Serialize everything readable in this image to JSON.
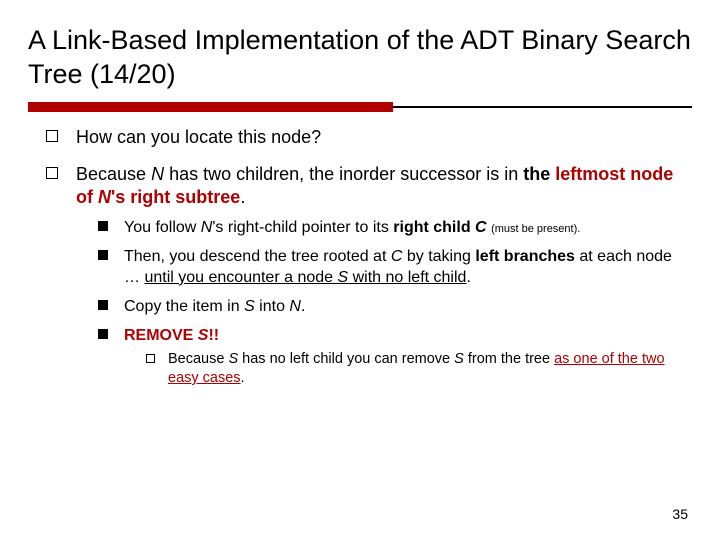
{
  "title": "A Link-Based Implementation of the ADT Binary Search Tree (14/20)",
  "bullets": {
    "b1": "How can you locate this node?",
    "b2_pre": "Because ",
    "b2_N": "N",
    "b2_mid": " has two children, the inorder successor is in ",
    "b2_bold1": "the ",
    "b2_red": "leftmost node of ",
    "b2_Npost": "N",
    "b2_red2": "'s right subtree",
    "b2_dot": ".",
    "s1_pre": "You follow ",
    "s1_N": "N",
    "s1_mid": "'s right-child pointer to its ",
    "s1_bold": "right child ",
    "s1_C": "C",
    "s1_small": "(must be present)",
    "s1_dot": ".",
    "s2_pre": "Then, you descend the tree rooted at ",
    "s2_C": "C",
    "s2_mid": " by taking ",
    "s2_bold": "left branches",
    "s2_mid2": " at each node … ",
    "s2_u": "until you encounter a node ",
    "s2_S": "S",
    "s2_u2": " with no left child",
    "s2_dot": ".",
    "s3_pre": "Copy the item in ",
    "s3_S": "S",
    "s3_mid": " into ",
    "s3_N": "N",
    "s3_dot": ".",
    "s4_bold": "REMOVE ",
    "s4_S": "S",
    "s4_excl": "!!",
    "t1_pre": "Because ",
    "t1_S": "S",
    "t1_mid": " has no left child you can remove ",
    "t1_S2": "S",
    "t1_mid2": " from the tree ",
    "t1_red": "as one of the two easy cases",
    "t1_dot": "."
  },
  "page_number": "35"
}
